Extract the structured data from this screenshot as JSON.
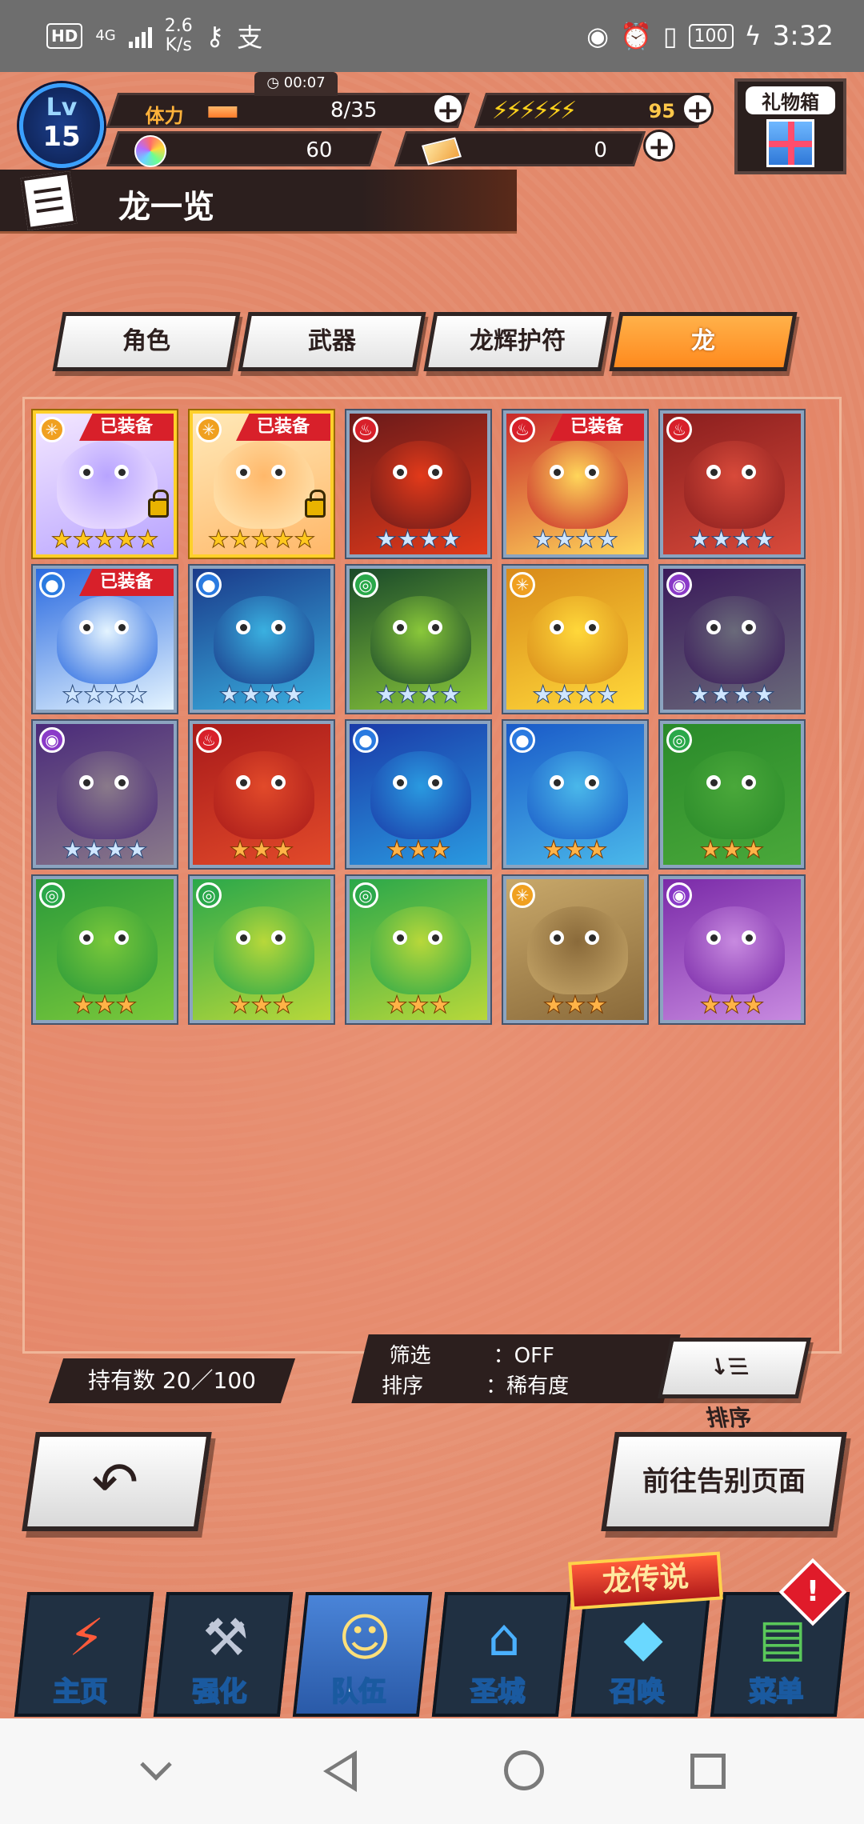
{
  "status_bar": {
    "hd": "HD",
    "network": "4G",
    "speed_value": "2.6",
    "speed_unit": "K/s",
    "key_icon": "vpn-key-icon",
    "pay_icon": "alipay-icon",
    "battery": "100",
    "time": "3:32"
  },
  "hud": {
    "level_label": "Lv",
    "level": "15",
    "timer": "00:07",
    "stamina_label": "体力",
    "stamina_value": "8/35",
    "energy_bolts": "⚡⚡⚡⚡⚡⚡",
    "energy_value": "95",
    "gems": "60",
    "tickets": "0",
    "gift_label": "礼物箱"
  },
  "title": "龙一览",
  "tabs": [
    {
      "label": "角色",
      "active": false
    },
    {
      "label": "武器",
      "active": false
    },
    {
      "label": "龙辉护符",
      "active": false
    },
    {
      "label": "龙",
      "active": true
    }
  ],
  "equipped_label": "已装备",
  "dragons": [
    {
      "element": "light",
      "stars": 5,
      "equipped": true,
      "locked": true,
      "colors": [
        "#f4e7ff",
        "#b8a4ff"
      ]
    },
    {
      "element": "light",
      "stars": 5,
      "equipped": true,
      "locked": true,
      "colors": [
        "#ffe9b8",
        "#ffb86a"
      ]
    },
    {
      "element": "fire",
      "stars": 4,
      "equipped": false,
      "locked": false,
      "colors": [
        "#6a1a1a",
        "#e23a1a"
      ]
    },
    {
      "element": "fire",
      "stars": 4,
      "equipped": true,
      "locked": false,
      "colors": [
        "#c82a2a",
        "#ffd65a"
      ]
    },
    {
      "element": "fire",
      "stars": 4,
      "equipped": false,
      "locked": false,
      "colors": [
        "#8a1e1e",
        "#d84a3a"
      ]
    },
    {
      "element": "water",
      "stars": 4,
      "equipped": true,
      "locked": false,
      "colors": [
        "#2a6ae0",
        "#e4f4ff"
      ]
    },
    {
      "element": "water",
      "stars": 4,
      "equipped": false,
      "locked": false,
      "colors": [
        "#1a3a8a",
        "#3ab0e0"
      ]
    },
    {
      "element": "wind",
      "stars": 4,
      "equipped": false,
      "locked": false,
      "colors": [
        "#1a4a2a",
        "#8ac83a"
      ]
    },
    {
      "element": "light",
      "stars": 4,
      "equipped": false,
      "locked": false,
      "colors": [
        "#d88a1a",
        "#ffd83a"
      ]
    },
    {
      "element": "shadow",
      "stars": 4,
      "equipped": false,
      "locked": false,
      "colors": [
        "#3a1a5a",
        "#6a6a7a"
      ]
    },
    {
      "element": "shadow",
      "stars": 4,
      "equipped": false,
      "locked": false,
      "colors": [
        "#4a2a7a",
        "#8a7a8a"
      ]
    },
    {
      "element": "fire",
      "stars": 3,
      "equipped": false,
      "locked": false,
      "colors": [
        "#a81a1a",
        "#e24a2a"
      ]
    },
    {
      "element": "water",
      "stars": 3,
      "equipped": false,
      "locked": false,
      "colors": [
        "#1a3aa8",
        "#2a9ae0"
      ]
    },
    {
      "element": "water",
      "stars": 3,
      "equipped": false,
      "locked": false,
      "colors": [
        "#1a5ac8",
        "#4ab8ea"
      ]
    },
    {
      "element": "wind",
      "stars": 3,
      "equipped": false,
      "locked": false,
      "colors": [
        "#2a8a2a",
        "#4aa83a"
      ]
    },
    {
      "element": "wind",
      "stars": 3,
      "equipped": false,
      "locked": false,
      "colors": [
        "#2a9a3a",
        "#7ac83a"
      ]
    },
    {
      "element": "wind",
      "stars": 3,
      "equipped": false,
      "locked": false,
      "colors": [
        "#2aa84a",
        "#b8d83a"
      ]
    },
    {
      "element": "wind",
      "stars": 3,
      "equipped": false,
      "locked": false,
      "colors": [
        "#2aa84a",
        "#b8d83a"
      ]
    },
    {
      "element": "light",
      "stars": 3,
      "equipped": false,
      "locked": false,
      "colors": [
        "#c8a86a",
        "#8a6a3a"
      ]
    },
    {
      "element": "shadow",
      "stars": 3,
      "equipped": false,
      "locked": false,
      "colors": [
        "#7a2aa8",
        "#c88ae0"
      ]
    }
  ],
  "element_styles": {
    "light": {
      "color": "#f0a020",
      "glyph": "✳"
    },
    "fire": {
      "color": "#d8202a",
      "glyph": "♨"
    },
    "water": {
      "color": "#2a7ae0",
      "glyph": "●"
    },
    "wind": {
      "color": "#2aa84a",
      "glyph": "◎"
    },
    "shadow": {
      "color": "#8a3ac8",
      "glyph": "◉"
    }
  },
  "footer": {
    "owned": "持有数  20／100",
    "filter_key": "筛选",
    "filter_value": "：OFF",
    "sort_key": "排序",
    "sort_value": "：稀有度",
    "sort_button": "排序",
    "sort_icon": "↓☰",
    "back_icon": "↶",
    "farewell_button": "前往告别页面"
  },
  "nav": {
    "legend_badge": "龙传说",
    "alert": "!",
    "items": [
      {
        "label": "主页",
        "icon": "home-icon",
        "active": false
      },
      {
        "label": "强化",
        "icon": "hammer-icon",
        "active": false
      },
      {
        "label": "队伍",
        "icon": "team-icon",
        "active": true
      },
      {
        "label": "圣城",
        "icon": "castle-icon",
        "active": false
      },
      {
        "label": "召唤",
        "icon": "crystal-icon",
        "active": false
      },
      {
        "label": "菜单",
        "icon": "book-icon",
        "active": false
      }
    ]
  }
}
